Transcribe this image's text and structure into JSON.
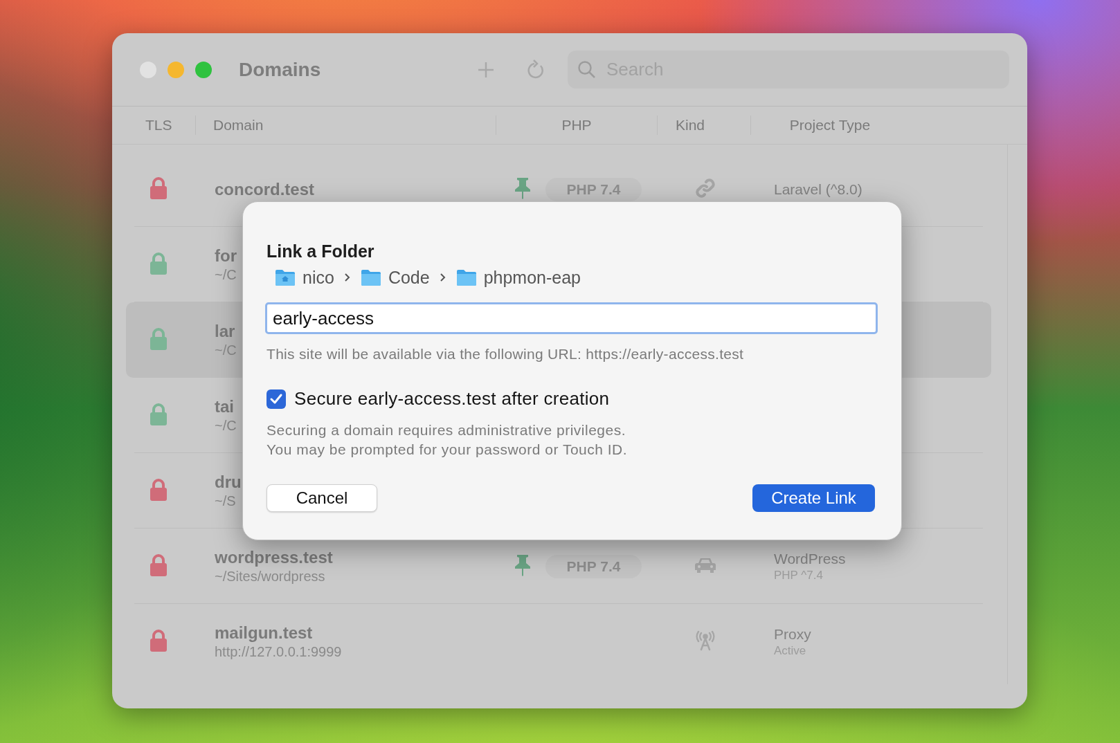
{
  "window": {
    "title": "Domains",
    "search": {
      "placeholder": "Search"
    }
  },
  "table": {
    "columns": [
      "TLS",
      "Domain",
      "PHP",
      "Kind",
      "Project Type"
    ],
    "rows": [
      {
        "name": "concord.test",
        "secured": false,
        "selected": false,
        "pinned": true,
        "php": "PHP 7.4",
        "kind": "link",
        "project": "Laravel (^8.0)"
      },
      {
        "name": "for",
        "path": "~/C",
        "secured": true,
        "selected": false
      },
      {
        "name": "lar",
        "path": "~/C",
        "secured": true,
        "selected": true
      },
      {
        "name": "tai",
        "path": "~/C",
        "secured": true,
        "selected": false
      },
      {
        "name": "dru",
        "path": "~/S",
        "secured": false,
        "selected": false
      },
      {
        "name": "wordpress.test",
        "path": "~/Sites/wordpress",
        "secured": false,
        "selected": false,
        "pinned": true,
        "php": "PHP 7.4",
        "kind": "park",
        "project": "WordPress",
        "project_detail": "PHP ^7.4"
      },
      {
        "name": "mailgun.test",
        "path": "http://127.0.0.1:9999",
        "secured": false,
        "selected": false,
        "pinned": false,
        "kind": "proxy",
        "project": "Proxy",
        "project_detail": "Active"
      }
    ]
  },
  "dialog": {
    "title": "Link a Folder",
    "breadcrumb": [
      {
        "label": "nico",
        "kind": "home"
      },
      {
        "label": "Code",
        "kind": "folder"
      },
      {
        "label": "phpmon-eap",
        "kind": "folder"
      }
    ],
    "field": {
      "value": "early-access"
    },
    "hint": "This site will be available via the following URL: https://early-access.test",
    "secure": {
      "label": "Secure early-access.test after creation",
      "checked": true
    },
    "note": [
      "Securing a domain requires administrative privileges.",
      "You may be prompted for your password or Touch ID."
    ],
    "buttons": [
      {
        "label": "Cancel",
        "kind": "secondary"
      },
      {
        "label": "Create Link",
        "kind": "primary"
      }
    ]
  }
}
